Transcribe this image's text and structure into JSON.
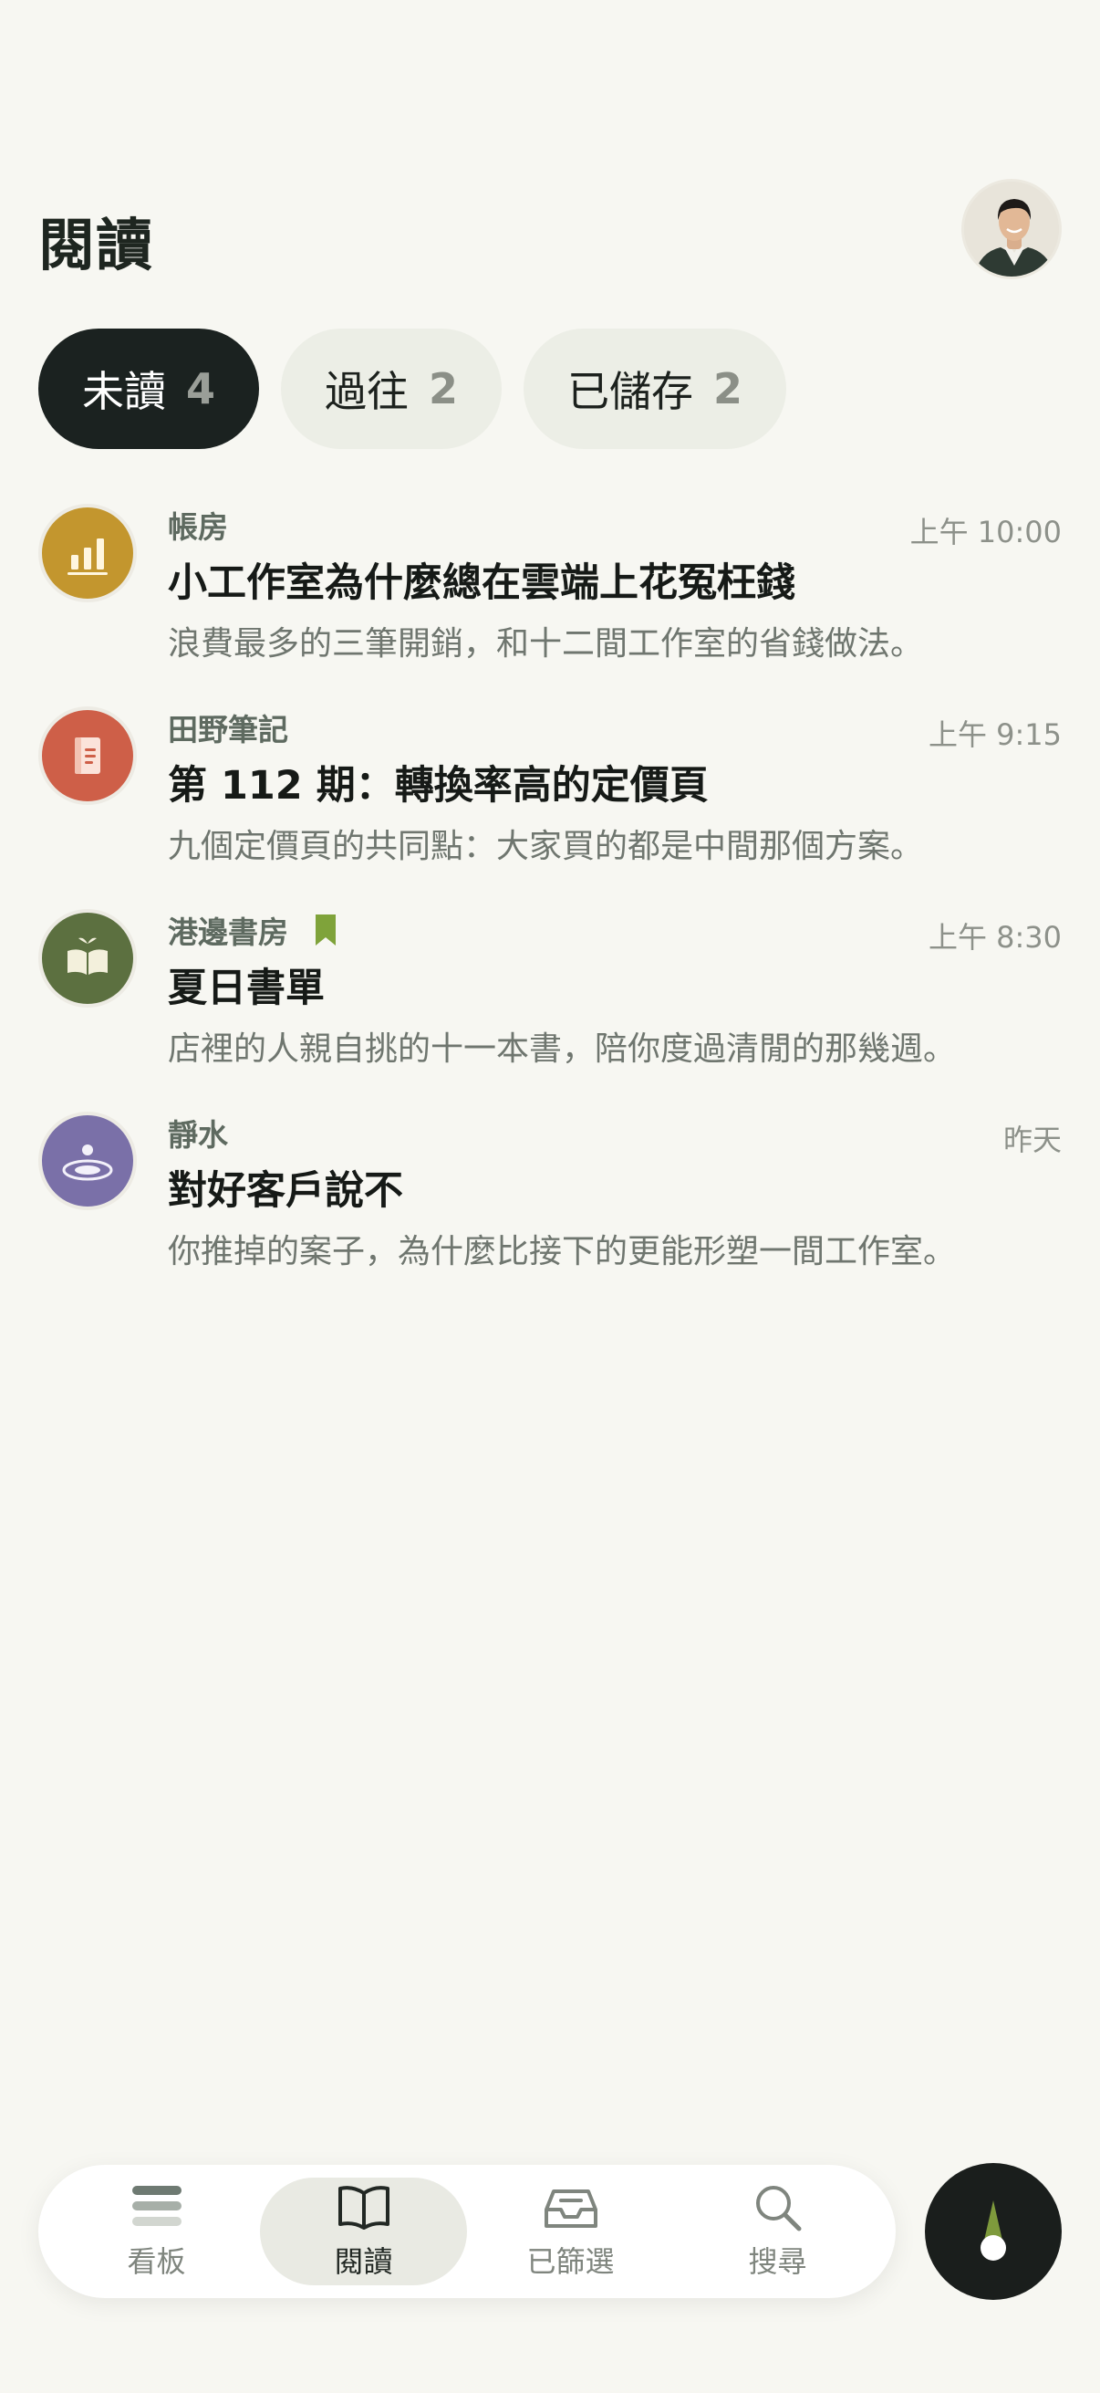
{
  "header": {
    "title": "閱讀"
  },
  "tabs": [
    {
      "label": "未讀",
      "count": "4"
    },
    {
      "label": "過往",
      "count": "2"
    },
    {
      "label": "已儲存",
      "count": "2"
    }
  ],
  "feed": [
    {
      "source": "帳房",
      "time": "上午 10:00",
      "title": "小工作室為什麼總在雲端上花冤枉錢",
      "summary": "浪費最多的三筆開銷，和十二間工作室的省錢做法。",
      "icon": "bar-chart-icon",
      "color": "#C3962E"
    },
    {
      "source": "田野筆記",
      "time": "上午 9:15",
      "title": "第 112 期：轉換率高的定價頁",
      "summary": "九個定價頁的共同點：大家買的都是中間那個方案。",
      "icon": "notebook-icon",
      "color": "#CE5F48"
    },
    {
      "source": "港邊書房",
      "time": "上午 8:30",
      "title": "夏日書單",
      "summary": "店裡的人親自挑的十一本書，陪你度過清閒的那幾週。",
      "icon": "open-book-icon",
      "color": "#5C7040",
      "bookmarked": true
    },
    {
      "source": "靜水",
      "time": "昨天",
      "title": "對好客戶說不",
      "summary": "你推掉的案子，為什麼比接下的更能形塑一間工作室。",
      "icon": "ripple-icon",
      "color": "#7A70A8"
    }
  ],
  "bottom_nav": [
    {
      "label": "看板",
      "icon": "stack-icon"
    },
    {
      "label": "閱讀",
      "icon": "book-icon",
      "active": true
    },
    {
      "label": "已篩選",
      "icon": "inbox-icon"
    },
    {
      "label": "搜尋",
      "icon": "search-icon"
    }
  ],
  "fab": {
    "icon": "compass-needle-icon"
  },
  "colors": {
    "background": "#F7F7F2",
    "active_tab": "#1B2220",
    "bookmark": "#7FA33A"
  }
}
